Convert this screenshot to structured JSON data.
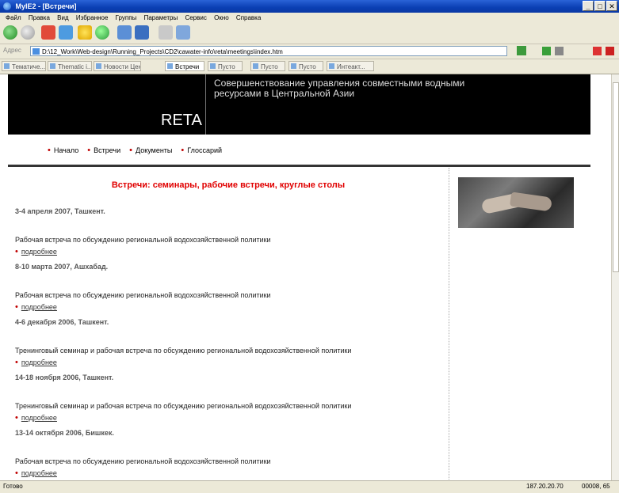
{
  "window": {
    "title": "MyIE2 - [Встречи]"
  },
  "menu": [
    "Файл",
    "Правка",
    "Вид",
    "Избранное",
    "Группы",
    "Параметры",
    "Сервис",
    "Окно",
    "Справка"
  ],
  "address": {
    "label": "Адрес",
    "url": "D:\\12_Work\\Web-design\\Running_Projects\\CD2\\cawater-info\\reta\\meetings\\index.htm"
  },
  "tabs": [
    "Тематиче...",
    "Thematic i...",
    "Новости Цен...",
    "Встречи",
    "Пусто",
    "Пусто",
    "Пусто",
    "Интеакт..."
  ],
  "site": {
    "brand": "RETA",
    "tagline": "Совершенствование управления совместными водными ресурсами в Центральной Азии",
    "nav": [
      "Начало",
      "Встречи",
      "Документы",
      "Глоссарий"
    ],
    "page_title": "Встречи: семинары, рабочие встречи, круглые столы",
    "more_label": "подробнее",
    "events": [
      {
        "date": "3-4 апреля 2007, Ташкент.",
        "desc": "Рабочая встреча по обсуждению региональной водохозяйственной политики"
      },
      {
        "date": "8-10 марта 2007, Ашхабад.",
        "desc": "Рабочая встреча по обсуждению региональной водохозяйственной политики"
      },
      {
        "date": "4-6 декабря 2006, Ташкент.",
        "desc": "Тренинговый семинар и рабочая встреча по обсуждению региональной водохозяйственной политики"
      },
      {
        "date": "14-18 ноября 2006, Ташкент.",
        "desc": "Тренинговый семинар и рабочая встреча по обсуждению региональной водохозяйственной политики"
      },
      {
        "date": "13-14 октября 2006, Бишкек.",
        "desc": "Рабочая встреча по обсуждению региональной водохозяйственной политики"
      }
    ]
  },
  "status": {
    "left": "Готово",
    "ip": "187.20.20.70",
    "counter": "00008, 65"
  },
  "colors": {
    "accent_red": "#e00000",
    "titlebar_blue": "#0a3fb3"
  }
}
